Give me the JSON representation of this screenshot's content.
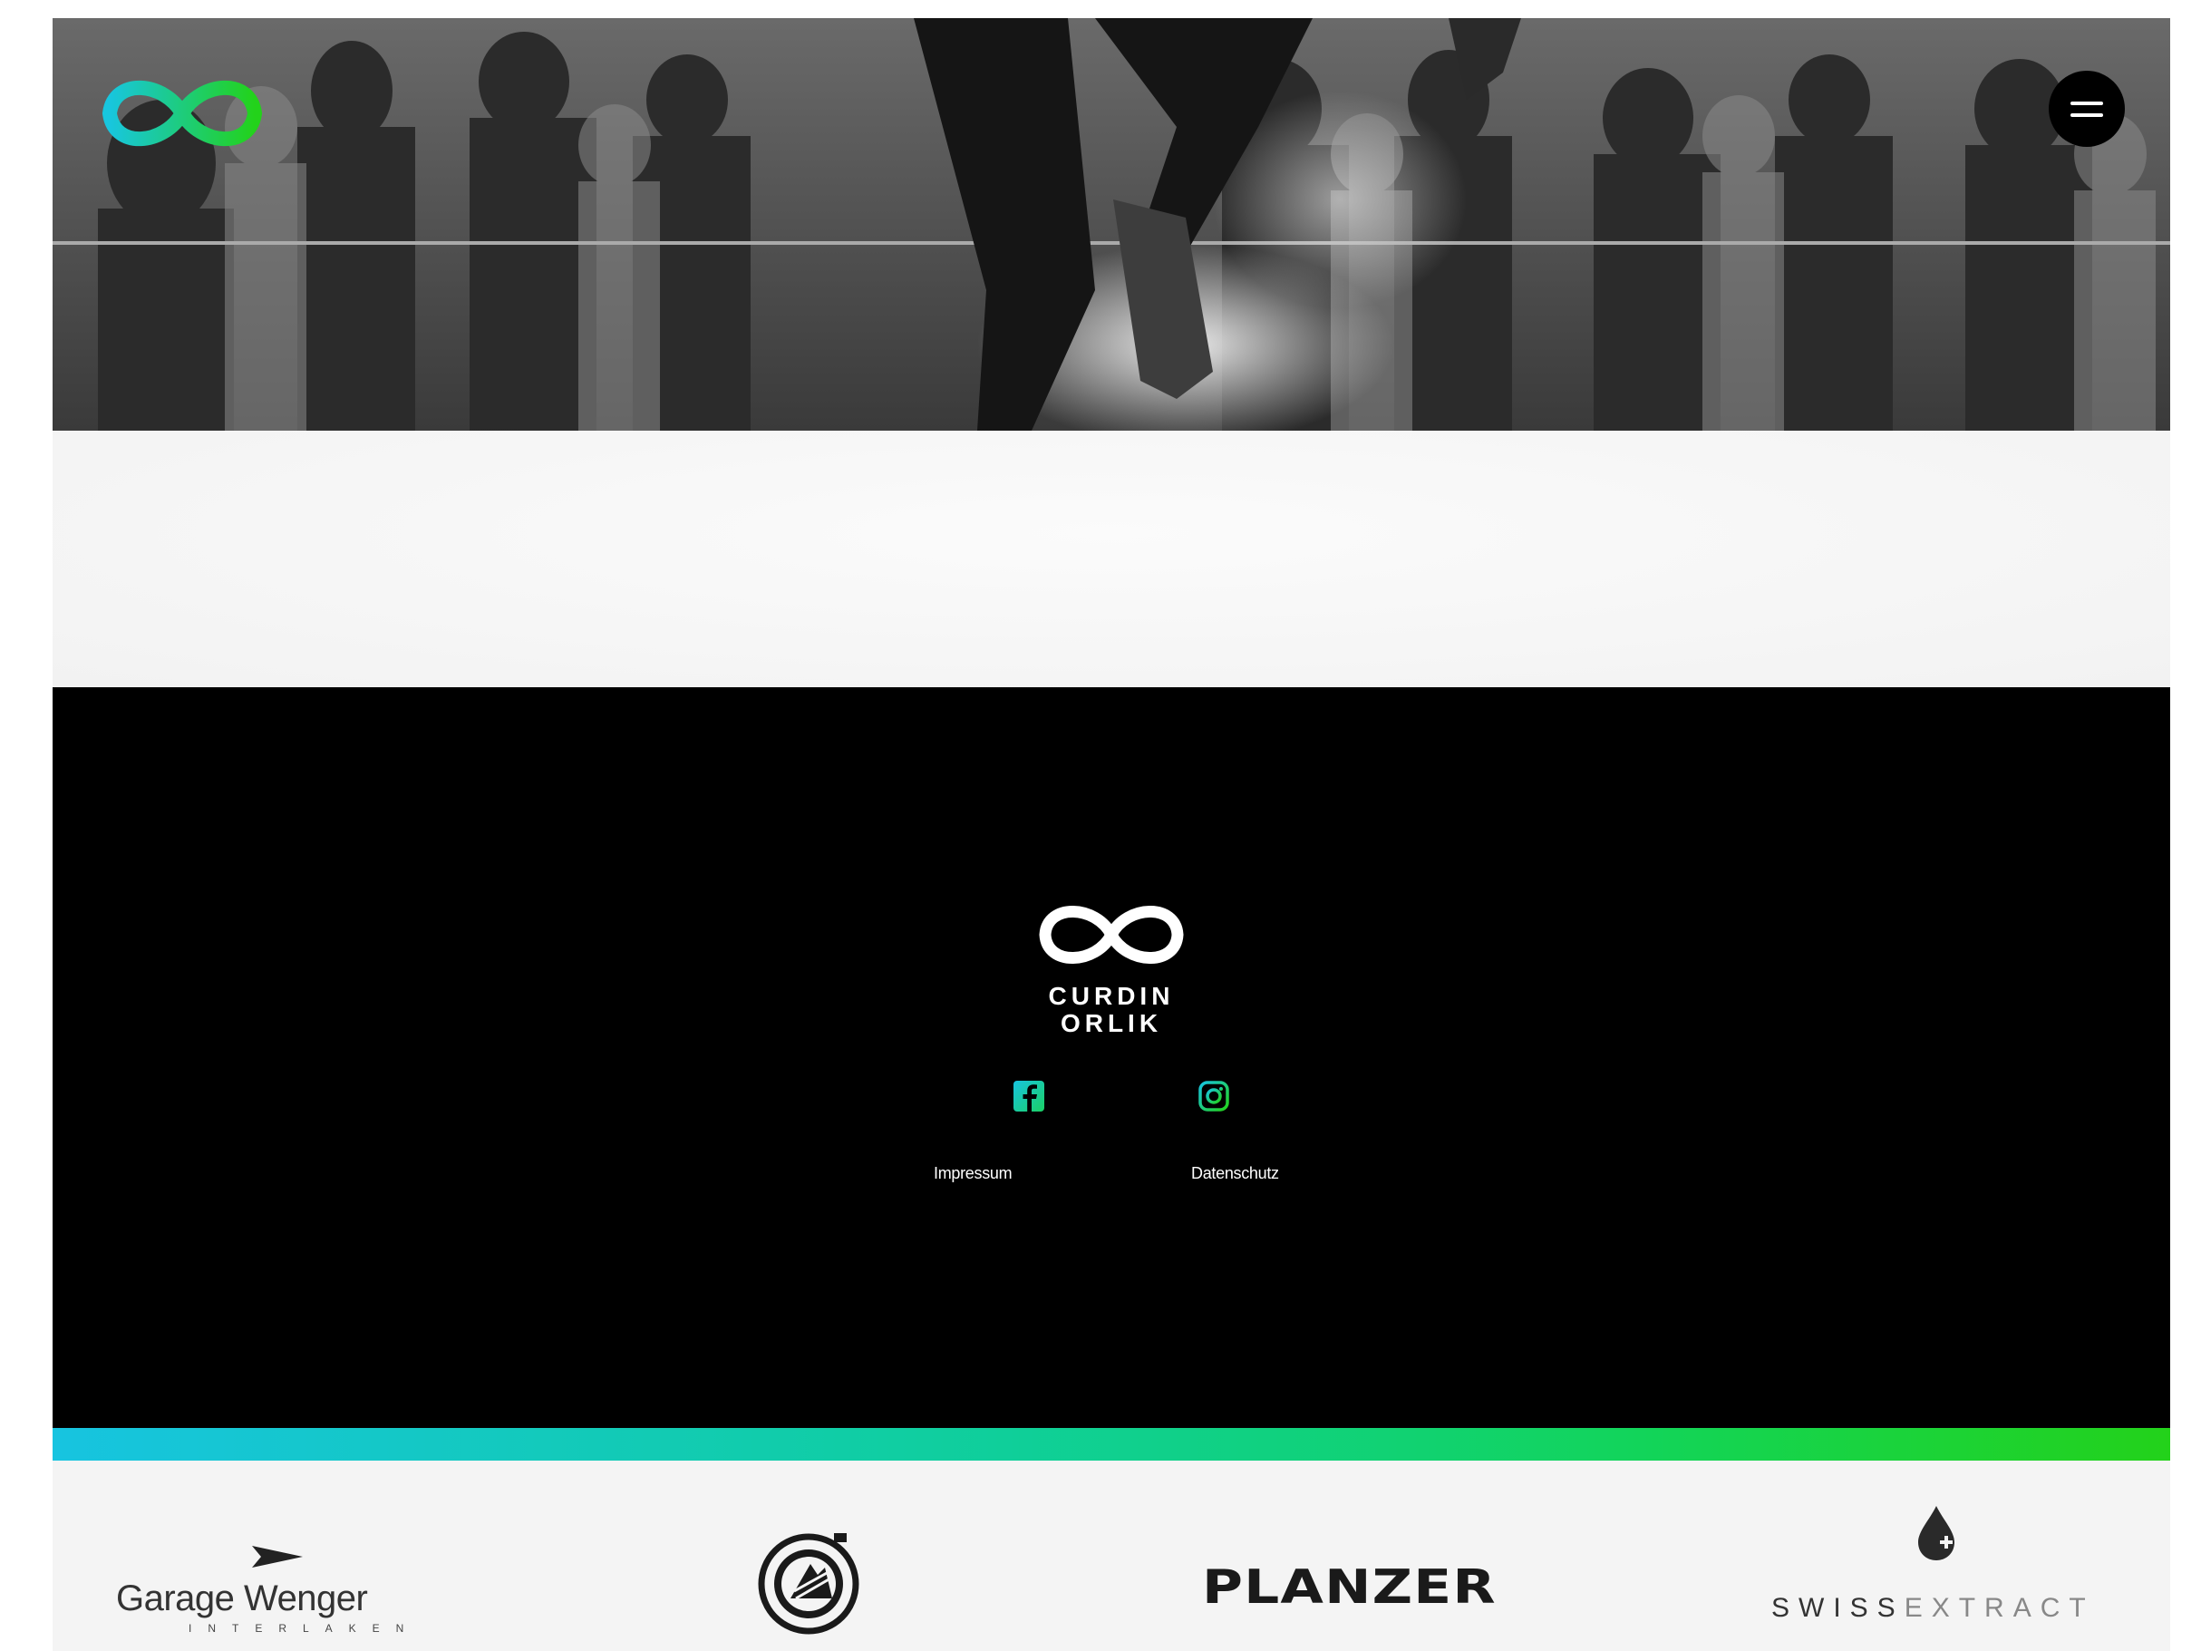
{
  "header": {
    "logo_icon": "infinity-logo-icon",
    "menu_icon": "hamburger-menu-icon"
  },
  "footer": {
    "brand_line1": "CURDIN",
    "brand_line2": "ORLIK",
    "social": [
      {
        "icon": "facebook-icon"
      },
      {
        "icon": "instagram-icon"
      }
    ],
    "links": {
      "impressum": "Impressum",
      "datenschutz": "Datenschutz"
    }
  },
  "colors": {
    "accent_start": "#17c4e0",
    "accent_end": "#23d21a",
    "footer_bg": "#000000",
    "page_bg": "#f4f4f4"
  },
  "sponsors": {
    "garage": {
      "name": "Garage Wenger",
      "sub": "INTERLAKEN"
    },
    "seal": {
      "icon": "mountain-seal-logo-icon"
    },
    "planzer": {
      "name": "PLANZER"
    },
    "swissextract": {
      "part1": "SWISS",
      "part2": "EXTRACT"
    }
  }
}
